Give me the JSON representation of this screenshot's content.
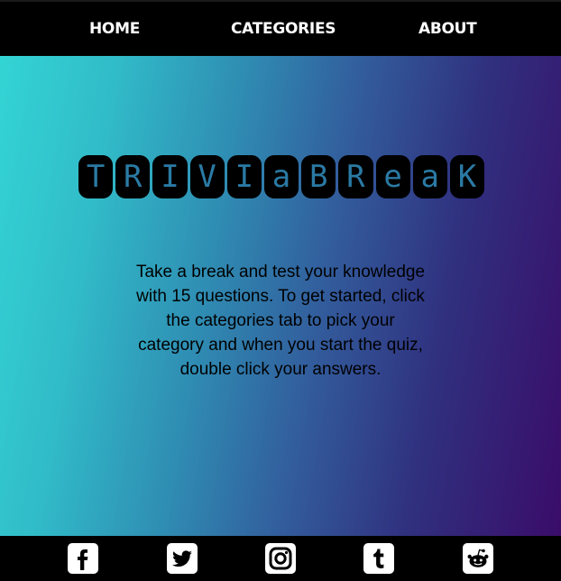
{
  "nav": {
    "home": "HOME",
    "categories": "CATEGORIES",
    "about": "ABOUT"
  },
  "logo": {
    "letters": [
      "T",
      "R",
      "I",
      "V",
      "I",
      "a",
      "B",
      "R",
      "e",
      "a",
      "K"
    ]
  },
  "intro": {
    "text": "Take a break and test your knowledge with 15 questions. To get started, click the categories tab to pick your category and when you start the quiz, double click your answers."
  },
  "footer": {
    "icons": [
      "facebook-icon",
      "twitter-icon",
      "instagram-icon",
      "tumblr-icon",
      "reddit-icon"
    ]
  },
  "colors": {
    "gradient_start": "#33d4d4",
    "gradient_end": "#3a0c6a",
    "logo_letter": "#2a7aa4"
  }
}
